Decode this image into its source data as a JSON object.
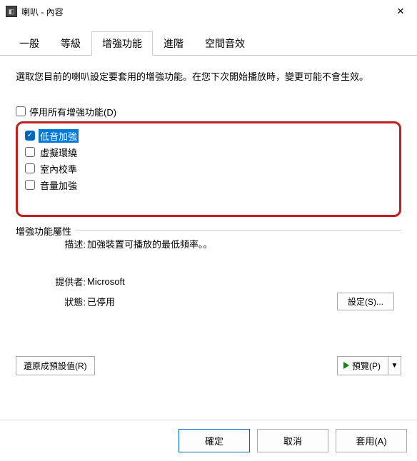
{
  "window": {
    "title": "喇叭 - 內容"
  },
  "tabs": [
    {
      "label": "一般"
    },
    {
      "label": "等級"
    },
    {
      "label": "增強功能"
    },
    {
      "label": "進階"
    },
    {
      "label": "空間音效"
    }
  ],
  "instruction": "選取您目前的喇叭設定要套用的增強功能。在您下次開始播放時，變更可能不會生效。",
  "disable_all": {
    "label": "停用所有增強功能(D)",
    "checked": false
  },
  "enhancements": [
    {
      "label": "低音加強",
      "checked": true,
      "selected": true
    },
    {
      "label": "虛擬環繞",
      "checked": false,
      "selected": false
    },
    {
      "label": "室內校準",
      "checked": false,
      "selected": false
    },
    {
      "label": "音量加強",
      "checked": false,
      "selected": false
    }
  ],
  "props": {
    "legend": "增強功能屬性",
    "desc_label": "描述:",
    "desc_value": "加強裝置可播放的最低頻率。。",
    "provider_label": "提供者:",
    "provider_value": "Microsoft",
    "status_label": "狀態:",
    "status_value": "已停用",
    "settings_button": "設定(S)..."
  },
  "buttons": {
    "restore": "還原成預設值(R)",
    "preview": "預覽(P)",
    "ok": "確定",
    "cancel": "取消",
    "apply": "套用(A)"
  }
}
